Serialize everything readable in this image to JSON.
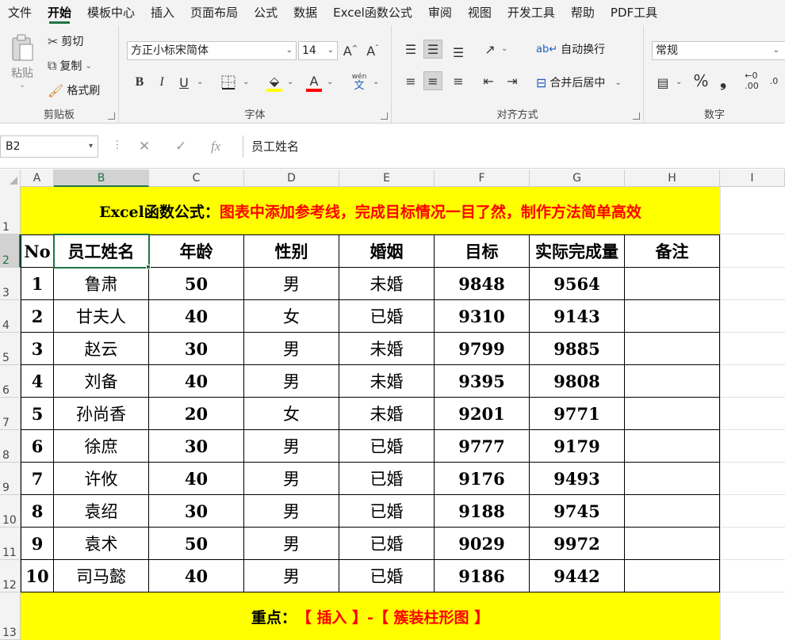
{
  "menu": {
    "items": [
      "文件",
      "开始",
      "模板中心",
      "插入",
      "页面布局",
      "公式",
      "数据",
      "Excel函数公式",
      "审阅",
      "视图",
      "开发工具",
      "帮助",
      "PDF工具"
    ],
    "active_index": 1
  },
  "ribbon": {
    "clipboard": {
      "label": "剪贴板",
      "paste": "粘贴",
      "cut": "剪切",
      "copy": "复制",
      "format_painter": "格式刷"
    },
    "font": {
      "label": "字体",
      "font_name": "方正小标宋简体",
      "font_size": "14",
      "bold": "B",
      "italic": "I",
      "underline": "U",
      "phonetic": "wén",
      "phonetic_sub": "文",
      "fill_color": "#ffff00",
      "font_color": "#ff0000"
    },
    "alignment": {
      "label": "对齐方式",
      "wrap_text": "自动换行",
      "merge_center": "合并后居中"
    },
    "number": {
      "label": "数字",
      "format": "常规",
      "percent": "%",
      "comma": "❟"
    }
  },
  "formula_bar": {
    "name_box": "B2",
    "fx": "fx",
    "content": "员工姓名"
  },
  "columns": [
    "A",
    "B",
    "C",
    "D",
    "E",
    "F",
    "G",
    "H",
    "I"
  ],
  "selected_column": "B",
  "rows": [
    "1",
    "2",
    "3",
    "4",
    "5",
    "6",
    "7",
    "8",
    "9",
    "10",
    "11",
    "12",
    "13"
  ],
  "selected_row": "2",
  "title": {
    "prefix": "Excel函数公式：",
    "text": "图表中添加参考线，完成目标情况一目了然，制作方法简单高效"
  },
  "table": {
    "headers": [
      "No",
      "员工姓名",
      "年龄",
      "性别",
      "婚姻",
      "目标",
      "实际完成量",
      "备注"
    ],
    "rows": [
      [
        "1",
        "鲁肃",
        "50",
        "男",
        "未婚",
        "9848",
        "9564",
        ""
      ],
      [
        "2",
        "甘夫人",
        "40",
        "女",
        "已婚",
        "9310",
        "9143",
        ""
      ],
      [
        "3",
        "赵云",
        "30",
        "男",
        "未婚",
        "9799",
        "9885",
        ""
      ],
      [
        "4",
        "刘备",
        "40",
        "男",
        "未婚",
        "9395",
        "9808",
        ""
      ],
      [
        "5",
        "孙尚香",
        "20",
        "女",
        "未婚",
        "9201",
        "9771",
        ""
      ],
      [
        "6",
        "徐庶",
        "30",
        "男",
        "已婚",
        "9777",
        "9179",
        ""
      ],
      [
        "7",
        "许攸",
        "40",
        "男",
        "已婚",
        "9176",
        "9493",
        ""
      ],
      [
        "8",
        "袁绍",
        "30",
        "男",
        "已婚",
        "9188",
        "9745",
        ""
      ],
      [
        "9",
        "袁术",
        "50",
        "男",
        "已婚",
        "9029",
        "9972",
        ""
      ],
      [
        "10",
        "司马懿",
        "40",
        "男",
        "已婚",
        "9186",
        "9442",
        ""
      ]
    ]
  },
  "footer": {
    "prefix": "重点：",
    "text": "【 插入 】-【 簇装柱形图 】"
  },
  "colors": {
    "accent": "#217346",
    "highlight": "#ffff00",
    "title_red": "#ff0000"
  }
}
